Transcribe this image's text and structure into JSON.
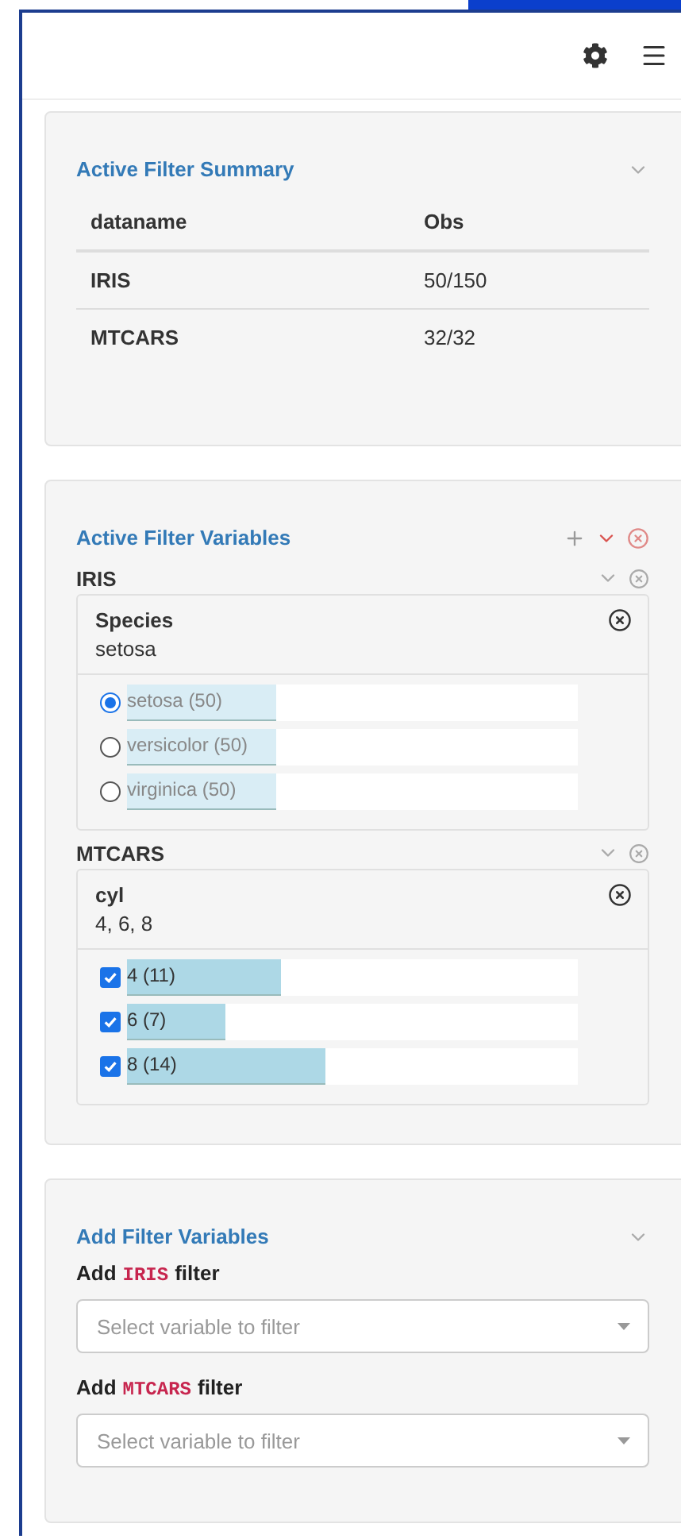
{
  "summary": {
    "title": "Active Filter Summary",
    "columns": [
      "dataname",
      "Obs"
    ],
    "rows": [
      [
        "IRIS",
        "50/150"
      ],
      [
        "MTCARS",
        "32/32"
      ]
    ]
  },
  "active": {
    "title": "Active Filter Variables",
    "datasets": [
      {
        "name": "IRIS",
        "filters": [
          {
            "variable": "Species",
            "value": "setosa",
            "kind": "radio",
            "options": [
              {
                "label": "setosa (50)",
                "selected": true,
                "level": 0.33
              },
              {
                "label": "versicolor (50)",
                "selected": false,
                "level": 0.33
              },
              {
                "label": "virginica (50)",
                "selected": false,
                "level": 0.33
              }
            ]
          }
        ]
      },
      {
        "name": "MTCARS",
        "filters": [
          {
            "variable": "cyl",
            "value": "4, 6, 8",
            "kind": "checkbox",
            "options": [
              {
                "label": "4 (11)",
                "checked": true,
                "level": 0.34
              },
              {
                "label": "6 (7)",
                "checked": true,
                "level": 0.22
              },
              {
                "label": "8 (14)",
                "checked": true,
                "level": 0.44
              }
            ]
          }
        ]
      }
    ]
  },
  "add": {
    "title": "Add Filter Variables",
    "sections": [
      {
        "prefix": "Add",
        "dataname": "IRIS",
        "suffix": "filter",
        "placeholder": "Select variable to filter"
      },
      {
        "prefix": "Add",
        "dataname": "MTCARS",
        "suffix": "filter",
        "placeholder": "Select variable to filter"
      }
    ]
  }
}
